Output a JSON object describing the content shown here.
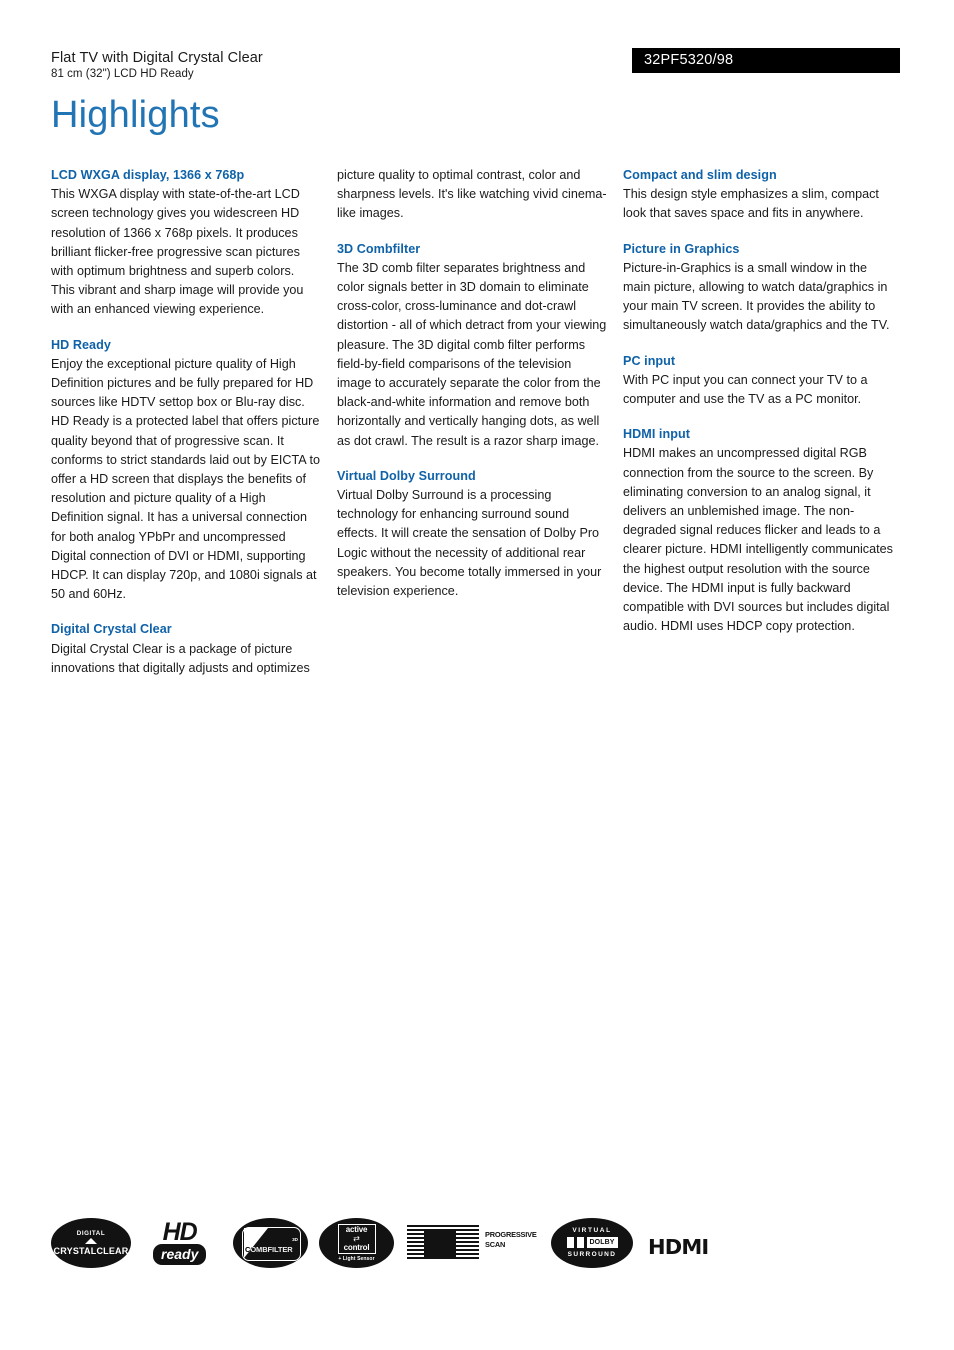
{
  "header": {
    "product_line": "Flat TV with Digital Crystal Clear",
    "product_spec": "81 cm (32\") LCD HD Ready",
    "model_number": "32PF5320/98",
    "page_title": "Highlights",
    "title_color": "#2275b5",
    "heading_color": "#0f62a8",
    "badge_bg": "#000000"
  },
  "columns": [
    {
      "features": [
        {
          "title": "LCD WXGA display, 1366 x 768p",
          "body": "This WXGA display with state-of-the-art LCD screen technology gives you widescreen HD resolution of 1366 x 768p pixels. It produces brilliant flicker-free progressive scan pictures with optimum brightness and superb colors. This vibrant and sharp image will provide you with an enhanced viewing experience."
        },
        {
          "title": "HD Ready",
          "body": "Enjoy the exceptional picture quality of High Definition pictures and be fully prepared for HD sources like HDTV settop box or Blu-ray disc. HD Ready is a protected label that offers picture quality beyond that of progressive scan. It conforms to strict standards laid out by EICTA to offer a HD screen that displays the benefits of resolution and picture quality of a High Definition signal. It has a universal connection for both analog YPbPr and uncompressed Digital connection of DVI or HDMI, supporting HDCP. It can display 720p, and 1080i signals at 50 and 60Hz."
        },
        {
          "title": "Digital Crystal Clear",
          "body": "Digital Crystal Clear is a package of picture innovations that digitally adjusts and optimizes"
        }
      ]
    },
    {
      "features": [
        {
          "title": "",
          "body": "picture quality to optimal contrast, color and sharpness levels. It's like watching vivid cinema-like images."
        },
        {
          "title": "3D Combfilter",
          "body": "The 3D comb filter separates brightness and color signals better in 3D domain to eliminate cross-color, cross-luminance and dot-crawl distortion - all of which detract from your viewing pleasure. The 3D digital comb filter performs field-by-field comparisons of the television image to accurately separate the color from the black-and-white information and remove both horizontally and vertically hanging dots, as well as dot crawl. The result is a razor sharp image."
        },
        {
          "title": "Virtual Dolby Surround",
          "body": "Virtual Dolby Surround is a processing technology for enhancing surround sound effects. It will create the sensation of Dolby Pro Logic without the necessity of additional rear speakers. You become totally immersed in your television experience."
        }
      ]
    },
    {
      "features": [
        {
          "title": "Compact and slim design",
          "body": "This design style emphasizes a slim, compact look that saves space and fits in anywhere."
        },
        {
          "title": "Picture in Graphics",
          "body": "Picture-in-Graphics is a small window in the main picture, allowing to watch data/graphics in your main TV screen. It provides the ability to simultaneously watch data/graphics and the TV."
        },
        {
          "title": "PC input",
          "body": "With PC input you can connect your TV to a computer and use the TV as a PC monitor."
        },
        {
          "title": "HDMI input",
          "body": "HDMI makes an uncompressed digital RGB connection from the source to the screen. By eliminating conversion to an analog signal, it delivers an unblemished image. The non-degraded signal reduces flicker and leads to a clearer picture. HDMI intelligently communicates the highest output resolution with the source device. The HDMI input is fully backward compatible with DVI sources but includes digital audio. HDMI uses HDCP copy protection."
        }
      ]
    }
  ],
  "logos": {
    "digital_crystal_clear": {
      "top": "DIGITAL",
      "bottom": "CRYSTALCLEAR"
    },
    "hd_ready": {
      "big": "HD",
      "small": "ready"
    },
    "combfilter": {
      "label": "COMBFILTER",
      "prefix": "3D"
    },
    "active_control": {
      "line1": "active",
      "arrows": "⇄",
      "line2": "control",
      "sub": "+ Light Sensor"
    },
    "progressive_scan": {
      "line1": "PROGRESSIVE",
      "line2": "SCAN"
    },
    "virtual_dolby": {
      "top": "VIRTUAL",
      "mark": "DOLBY",
      "bottom": "SURROUND"
    },
    "hdmi": {
      "label": "HDMI"
    }
  }
}
